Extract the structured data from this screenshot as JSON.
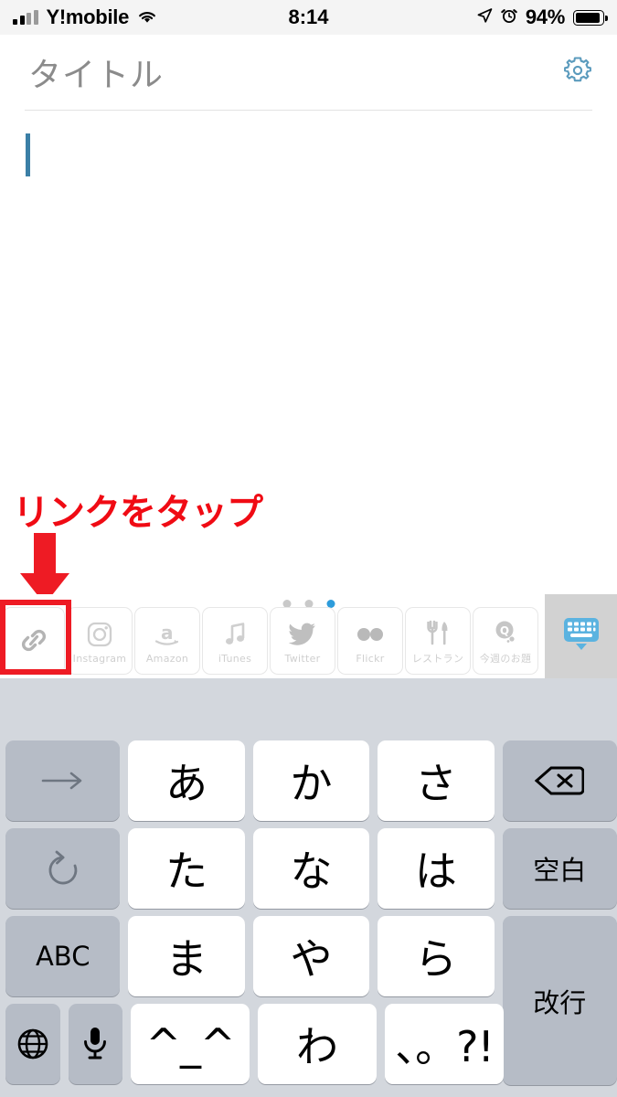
{
  "status_bar": {
    "carrier": "Y!mobile",
    "time": "8:14",
    "battery_text": "94%",
    "battery_level": 94,
    "icons": [
      "signal-bars-icon",
      "wifi-icon",
      "location-arrow-icon",
      "alarm-clock-icon",
      "battery-icon"
    ]
  },
  "note_header": {
    "title_placeholder": "タイトル",
    "settings_icon": "gear-icon"
  },
  "note_body": {
    "text": "",
    "caret_visible": true
  },
  "annotation": {
    "text": "リンクをタップ",
    "color": "#ee1b24",
    "arrow_icon": "down-arrow-icon",
    "highlight_target": "link-toolbar-item"
  },
  "accessory_bar": {
    "page_dots": {
      "count": 3,
      "active_index": 2,
      "active_color": "#2d9cdb"
    },
    "items": [
      {
        "label": "",
        "icon": "link-icon",
        "name": "link"
      },
      {
        "label": "Instagram",
        "icon": "instagram-icon",
        "name": "instagram"
      },
      {
        "label": "Amazon",
        "icon": "amazon-icon",
        "name": "amazon"
      },
      {
        "label": "iTunes",
        "icon": "music-note-icon",
        "name": "itunes"
      },
      {
        "label": "Twitter",
        "icon": "twitter-bird-icon",
        "name": "twitter"
      },
      {
        "label": "Flickr",
        "icon": "flickr-dots-icon",
        "name": "flickr"
      },
      {
        "label": "レストラン",
        "icon": "fork-knife-icon",
        "name": "restaurant"
      },
      {
        "label": "今週のお題",
        "icon": "question-bubble-icon",
        "name": "weekly-topic"
      }
    ],
    "dismiss": {
      "icon": "keyboard-dismiss-icon",
      "color": "#5bb3e0"
    }
  },
  "keyboard": {
    "type": "japanese-kana-12key",
    "rows": [
      [
        {
          "label": "→",
          "name": "cursor-right-key",
          "kind": "fn"
        },
        {
          "label": "あ",
          "name": "key-a",
          "kind": "char"
        },
        {
          "label": "か",
          "name": "key-ka",
          "kind": "char"
        },
        {
          "label": "さ",
          "name": "key-sa",
          "kind": "char"
        },
        {
          "label": "⌫",
          "name": "delete-key",
          "kind": "fn"
        }
      ],
      [
        {
          "label": "↺",
          "name": "undo-key",
          "kind": "fn"
        },
        {
          "label": "た",
          "name": "key-ta",
          "kind": "char"
        },
        {
          "label": "な",
          "name": "key-na",
          "kind": "char"
        },
        {
          "label": "は",
          "name": "key-ha",
          "kind": "char"
        },
        {
          "label": "空白",
          "name": "space-key",
          "kind": "fn"
        }
      ],
      [
        {
          "label": "ABC",
          "name": "abc-key",
          "kind": "fn"
        },
        {
          "label": "ま",
          "name": "key-ma",
          "kind": "char"
        },
        {
          "label": "や",
          "name": "key-ya",
          "kind": "char"
        },
        {
          "label": "ら",
          "name": "key-ra",
          "kind": "char"
        },
        {
          "label": "改行",
          "name": "return-key",
          "kind": "fn"
        }
      ],
      [
        {
          "label": "",
          "name": "globe-key",
          "kind": "fn"
        },
        {
          "label": "",
          "name": "mic-key",
          "kind": "fn"
        },
        {
          "label": "^_^",
          "name": "key-kaomoji",
          "kind": "char"
        },
        {
          "label": "わ",
          "name": "key-wa",
          "kind": "char"
        },
        {
          "label": "、。?!",
          "name": "key-punctuation",
          "kind": "char"
        }
      ]
    ]
  },
  "colors": {
    "accent_blue": "#2d9cdb",
    "gear_blue": "#5b9bbd",
    "annotation_red": "#ee1b24",
    "keyboard_bg": "#d3d7dd",
    "key_white": "#ffffff",
    "key_fn": "#b6bcc6"
  }
}
